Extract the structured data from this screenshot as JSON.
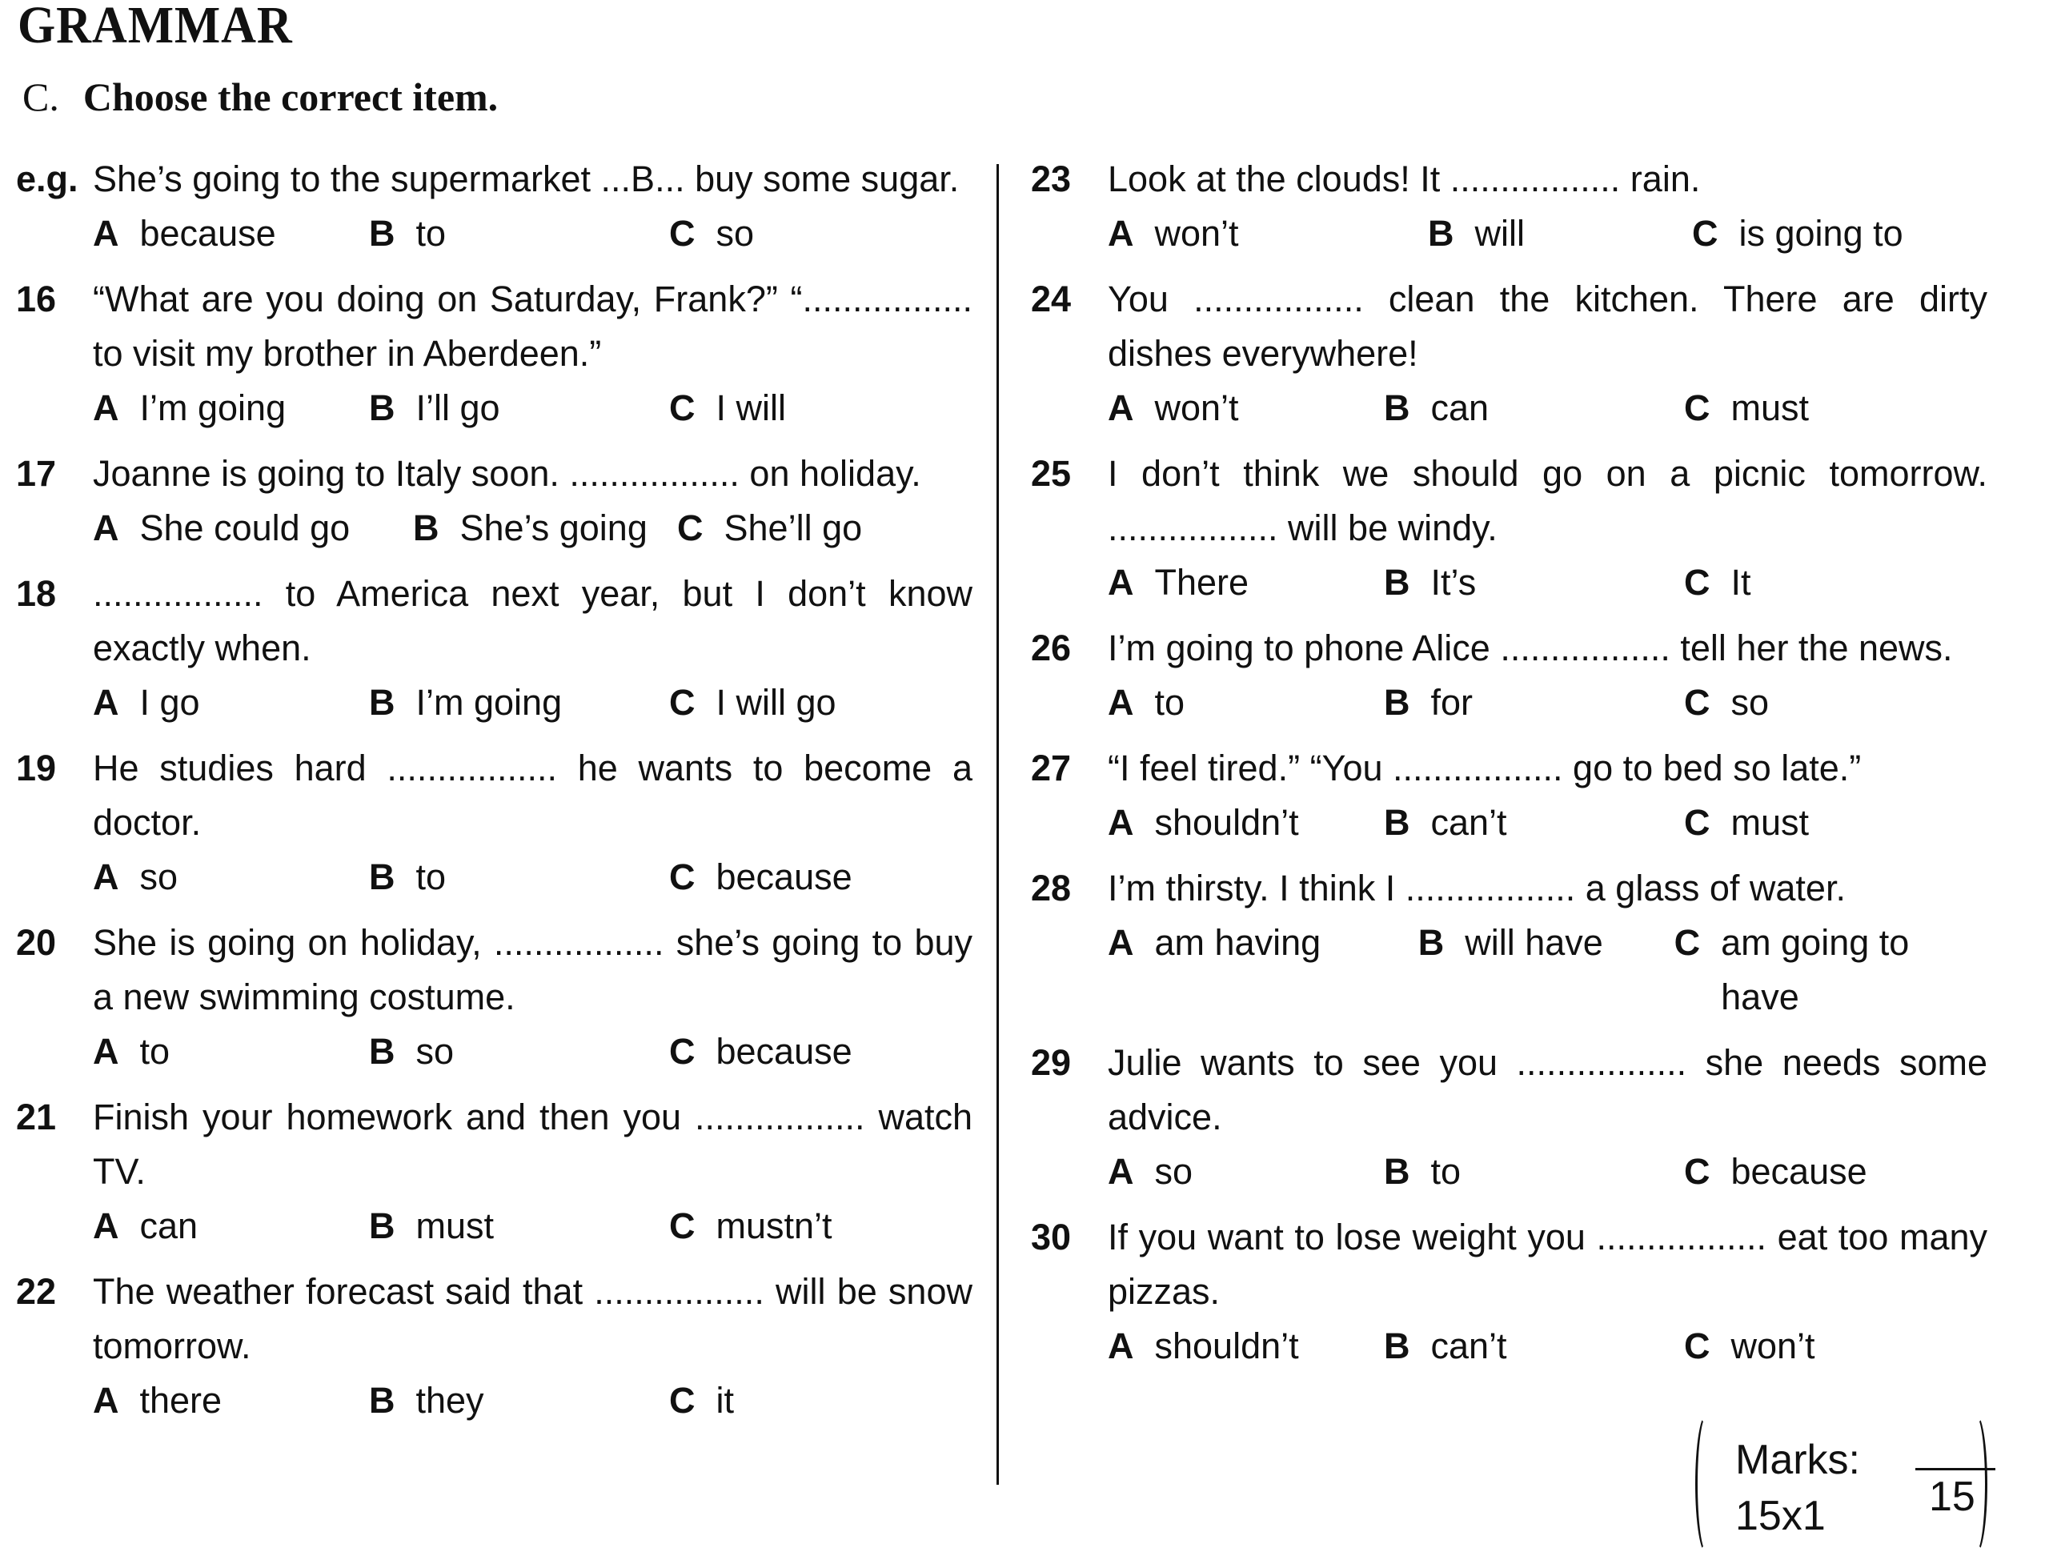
{
  "section": {
    "title": "GRAMMAR"
  },
  "exercise": {
    "letter": "C.",
    "instruction": "Choose the correct item."
  },
  "left_column": [
    {
      "num": "e.g.",
      "stem": "She’s going to the supermarket ...B... buy some sugar.",
      "options": [
        {
          "letter": "A",
          "text": "because"
        },
        {
          "letter": "B",
          "text": "to"
        },
        {
          "letter": "C",
          "text": "so"
        }
      ]
    },
    {
      "num": "16",
      "stem": "“What are you doing on Saturday, Frank?” “................. to visit my brother in Aberdeen.”",
      "options": [
        {
          "letter": "A",
          "text": "I’m going"
        },
        {
          "letter": "B",
          "text": "I’ll go"
        },
        {
          "letter": "C",
          "text": "I will"
        }
      ]
    },
    {
      "num": "17",
      "stem": "Joanne is going to Italy soon. ................. on holiday.",
      "options": [
        {
          "letter": "A",
          "text": "She could go"
        },
        {
          "letter": "B",
          "text": "She’s going"
        },
        {
          "letter": "C",
          "text": "She’ll go"
        }
      ]
    },
    {
      "num": "18",
      "stem": "................. to America next year, but I don’t know exactly when.",
      "options": [
        {
          "letter": "A",
          "text": "I go"
        },
        {
          "letter": "B",
          "text": "I’m going"
        },
        {
          "letter": "C",
          "text": "I will go"
        }
      ]
    },
    {
      "num": "19",
      "stem": "He studies hard ................. he wants to become a doctor.",
      "options": [
        {
          "letter": "A",
          "text": "so"
        },
        {
          "letter": "B",
          "text": "to"
        },
        {
          "letter": "C",
          "text": "because"
        }
      ]
    },
    {
      "num": "20",
      "stem": "She is going on holiday, ................. she’s going to buy a new swimming costume.",
      "options": [
        {
          "letter": "A",
          "text": "to"
        },
        {
          "letter": "B",
          "text": "so"
        },
        {
          "letter": "C",
          "text": "because"
        }
      ]
    },
    {
      "num": "21",
      "stem": "Finish your homework and then you ................. watch TV.",
      "options": [
        {
          "letter": "A",
          "text": "can"
        },
        {
          "letter": "B",
          "text": "must"
        },
        {
          "letter": "C",
          "text": "mustn’t"
        }
      ]
    },
    {
      "num": "22",
      "stem": "The weather forecast said that ................. will be snow tomorrow.",
      "options": [
        {
          "letter": "A",
          "text": "there"
        },
        {
          "letter": "B",
          "text": "they"
        },
        {
          "letter": "C",
          "text": "it"
        }
      ]
    }
  ],
  "right_column": [
    {
      "num": "23",
      "stem": "Look at the clouds! It ................. rain.",
      "options": [
        {
          "letter": "A",
          "text": "won’t"
        },
        {
          "letter": "B",
          "text": "will"
        },
        {
          "letter": "C",
          "text": "is going to"
        }
      ]
    },
    {
      "num": "24",
      "stem": "You ................. clean the kitchen. There are dirty dishes everywhere!",
      "options": [
        {
          "letter": "A",
          "text": "won’t"
        },
        {
          "letter": "B",
          "text": "can"
        },
        {
          "letter": "C",
          "text": "must"
        }
      ]
    },
    {
      "num": "25",
      "stem": "I don’t think we should go on a picnic tomorrow. ................. will be windy.",
      "options": [
        {
          "letter": "A",
          "text": "There"
        },
        {
          "letter": "B",
          "text": "It’s"
        },
        {
          "letter": "C",
          "text": "It"
        }
      ]
    },
    {
      "num": "26",
      "stem": "I’m going to phone Alice ................. tell her the news.",
      "options": [
        {
          "letter": "A",
          "text": "to"
        },
        {
          "letter": "B",
          "text": "for"
        },
        {
          "letter": "C",
          "text": "so"
        }
      ]
    },
    {
      "num": "27",
      "stem": "“I feel tired.” “You ................. go to bed so late.”",
      "options": [
        {
          "letter": "A",
          "text": "shouldn’t"
        },
        {
          "letter": "B",
          "text": "can’t"
        },
        {
          "letter": "C",
          "text": "must"
        }
      ]
    },
    {
      "num": "28",
      "stem": "I’m thirsty. I think I ................. a glass of water.",
      "options": [
        {
          "letter": "A",
          "text": "am having"
        },
        {
          "letter": "B",
          "text": "will have"
        },
        {
          "letter": "C",
          "text": "am going to have"
        }
      ]
    },
    {
      "num": "29",
      "stem": "Julie wants to see you ................. she needs some advice.",
      "options": [
        {
          "letter": "A",
          "text": "so"
        },
        {
          "letter": "B",
          "text": "to"
        },
        {
          "letter": "C",
          "text": "because"
        }
      ]
    },
    {
      "num": "30",
      "stem": "If you want to lose weight you ................. eat too many pizzas.",
      "options": [
        {
          "letter": "A",
          "text": "shouldn’t"
        },
        {
          "letter": "B",
          "text": "can’t"
        },
        {
          "letter": "C",
          "text": "won’t"
        }
      ]
    }
  ],
  "marks": {
    "label": "Marks:",
    "calculation": "15x1",
    "total": "15"
  }
}
